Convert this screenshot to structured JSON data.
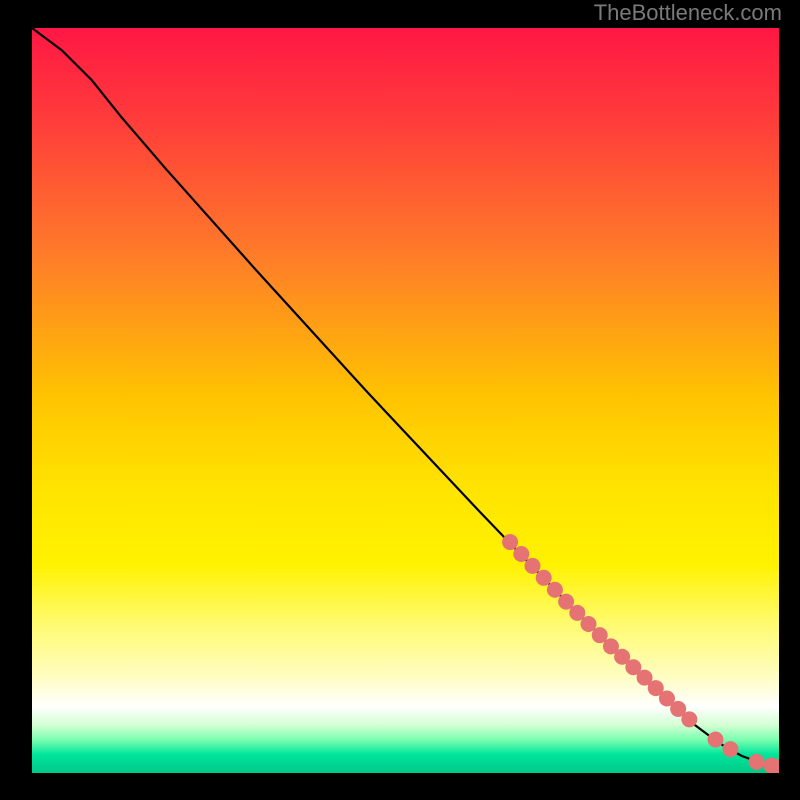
{
  "watermark": "TheBottleneck.com",
  "gradient": {
    "stops": [
      {
        "offset": 0.0,
        "color": "#ff1744"
      },
      {
        "offset": 0.12,
        "color": "#ff3b3b"
      },
      {
        "offset": 0.3,
        "color": "#ff7a2a"
      },
      {
        "offset": 0.5,
        "color": "#ffc500"
      },
      {
        "offset": 0.62,
        "color": "#ffe400"
      },
      {
        "offset": 0.72,
        "color": "#fff200"
      },
      {
        "offset": 0.8,
        "color": "#fffb70"
      },
      {
        "offset": 0.87,
        "color": "#fffdc0"
      },
      {
        "offset": 0.91,
        "color": "#ffffff"
      },
      {
        "offset": 0.935,
        "color": "#d5ffd5"
      },
      {
        "offset": 0.955,
        "color": "#7dffb0"
      },
      {
        "offset": 0.975,
        "color": "#00e59c"
      },
      {
        "offset": 1.0,
        "color": "#00c986"
      }
    ]
  },
  "chart_data": {
    "type": "line",
    "title": "",
    "xlabel": "",
    "ylabel": "",
    "xlim": [
      0,
      100
    ],
    "ylim": [
      0,
      100
    ],
    "series": [
      {
        "name": "curve",
        "style": "line-black",
        "x": [
          0,
          4,
          8,
          12,
          18,
          30,
          45,
          60,
          72,
          82,
          88,
          92,
          95,
          98,
          100
        ],
        "y": [
          100,
          97,
          93,
          88,
          81,
          67.5,
          51,
          35,
          22.5,
          12.5,
          7,
          4,
          2.3,
          1.2,
          0.8
        ]
      },
      {
        "name": "highlight-points",
        "style": "dots-salmon",
        "x": [
          64,
          65.5,
          67,
          68.5,
          70,
          71.5,
          73,
          74.5,
          76,
          77.5,
          79,
          80.5,
          82,
          83.5,
          85,
          86.5,
          88,
          91.5,
          93.5,
          97,
          99,
          100
        ],
        "y": [
          31,
          29.4,
          27.8,
          26.2,
          24.6,
          23,
          21.5,
          20,
          18.5,
          17,
          15.6,
          14.2,
          12.8,
          11.4,
          10,
          8.6,
          7.2,
          4.5,
          3.2,
          1.5,
          1,
          0.8
        ]
      }
    ],
    "colors": {
      "line-black": "#000000",
      "dots-salmon": "#e57373"
    }
  }
}
